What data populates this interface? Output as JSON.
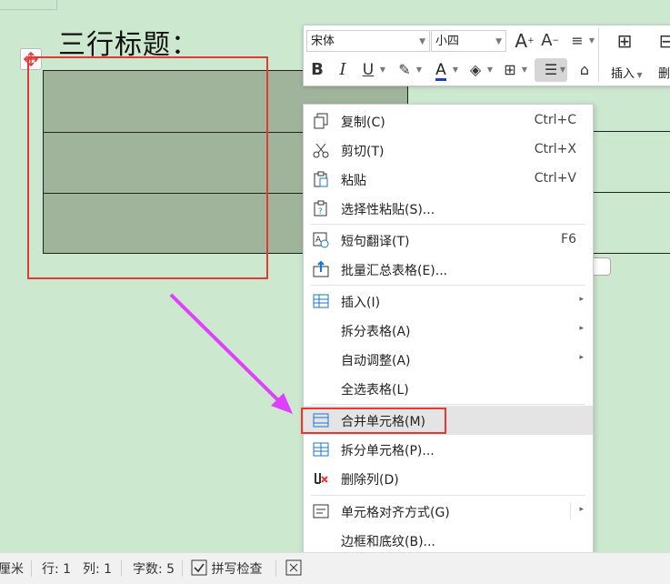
{
  "document": {
    "heading": "三行标题："
  },
  "toolbar": {
    "font_name": "宋体",
    "font_size": "小四",
    "insert_label": "插入",
    "delete_label": "删"
  },
  "context_menu": {
    "items": [
      {
        "label": "复制(C)",
        "shortcut": "Ctrl+C",
        "icon": "copy-icon"
      },
      {
        "label": "剪切(T)",
        "shortcut": "Ctrl+X",
        "icon": "scissors-icon"
      },
      {
        "label": "粘贴",
        "shortcut": "Ctrl+V",
        "icon": "paste-icon"
      },
      {
        "label": "选择性粘贴(S)...",
        "shortcut": "",
        "icon": "paste-special-icon"
      },
      {
        "label": "短句翻译(T)",
        "shortcut": "F6",
        "icon": "translate-icon"
      },
      {
        "label": "批量汇总表格(E)...",
        "shortcut": "",
        "icon": "batch-summary-icon"
      },
      {
        "label": "插入(I)",
        "shortcut": "",
        "icon": "table-insert-icon"
      },
      {
        "label": "拆分表格(A)",
        "shortcut": "",
        "icon": ""
      },
      {
        "label": "自动调整(A)",
        "shortcut": "",
        "icon": ""
      },
      {
        "label": "全选表格(L)",
        "shortcut": "",
        "icon": ""
      },
      {
        "label": "合并单元格(M)",
        "shortcut": "",
        "icon": "merge-cells-icon"
      },
      {
        "label": "拆分单元格(P)...",
        "shortcut": "",
        "icon": "split-cells-icon"
      },
      {
        "label": "删除列(D)",
        "shortcut": "",
        "icon": "delete-column-icon"
      },
      {
        "label": "单元格对齐方式(G)",
        "shortcut": "",
        "icon": "cell-align-icon"
      },
      {
        "label": "边框和底纹(B)...",
        "shortcut": "",
        "icon": ""
      }
    ]
  },
  "status_bar": {
    "unit": "厘米",
    "row": "行: 1",
    "col": "列: 1",
    "word_count": "字数: 5",
    "spell_check": "拼写检查"
  },
  "colors": {
    "page_bg": "#cce8cf",
    "table_fill": "#a0b49c",
    "highlight_red": "#e53935",
    "arrow_magenta": "#e040fb"
  }
}
